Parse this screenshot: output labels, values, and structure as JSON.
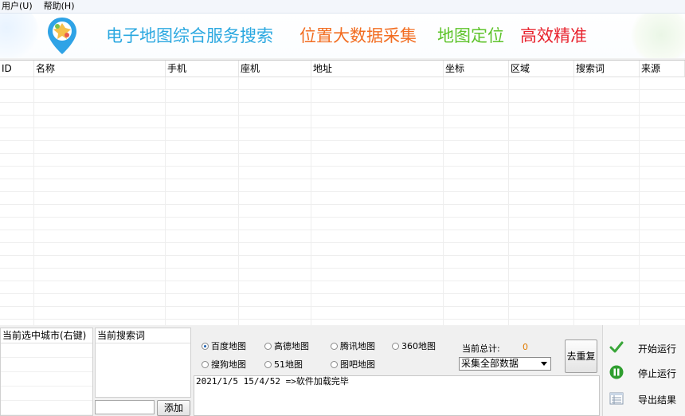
{
  "menu": [
    "用户(U)",
    "帮助(H)"
  ],
  "banner": {
    "slogans": [
      {
        "text": "电子地图综合服务搜索",
        "color": "#2ba8e0"
      },
      {
        "text": "位置大数据采集",
        "color": "#f26d21"
      },
      {
        "text": "地图定位",
        "color": "#5ec32b"
      },
      {
        "text": "高效精准",
        "color": "#e8232e"
      }
    ]
  },
  "table": {
    "columns": [
      "ID",
      "名称",
      "手机",
      "座机",
      "地址",
      "坐标",
      "区域",
      "搜索词",
      "来源"
    ]
  },
  "city_panel": {
    "header": "当前选中城市(右键)"
  },
  "keyword_panel": {
    "header": "当前搜索词",
    "input_value": "",
    "add_label": "添加"
  },
  "sources": [
    {
      "label": "百度地图",
      "selected": true
    },
    {
      "label": "高德地图",
      "selected": false
    },
    {
      "label": "腾讯地图",
      "selected": false
    },
    {
      "label": "360地图",
      "selected": false
    },
    {
      "label": "搜狗地图",
      "selected": false
    },
    {
      "label": "51地图",
      "selected": false
    },
    {
      "label": "图吧地图",
      "selected": false
    }
  ],
  "total": {
    "label": "当前总计:",
    "value": "0"
  },
  "collect_mode": {
    "selected": "采集全部数据"
  },
  "dedup_label": "去重复",
  "log": [
    "2021/1/5 15/4/52 =>软件加载完毕"
  ],
  "actions": [
    {
      "label": "开始运行",
      "icon": "checkmark-icon"
    },
    {
      "label": "停止运行",
      "icon": "pause-icon"
    },
    {
      "label": "导出结果",
      "icon": "table-export-icon"
    }
  ],
  "colors": {
    "accent_blue": "#2ba8e0",
    "accent_orange": "#f26d21",
    "accent_green": "#5ec32b",
    "accent_red": "#e8232e",
    "total_value": "#e07b00"
  }
}
